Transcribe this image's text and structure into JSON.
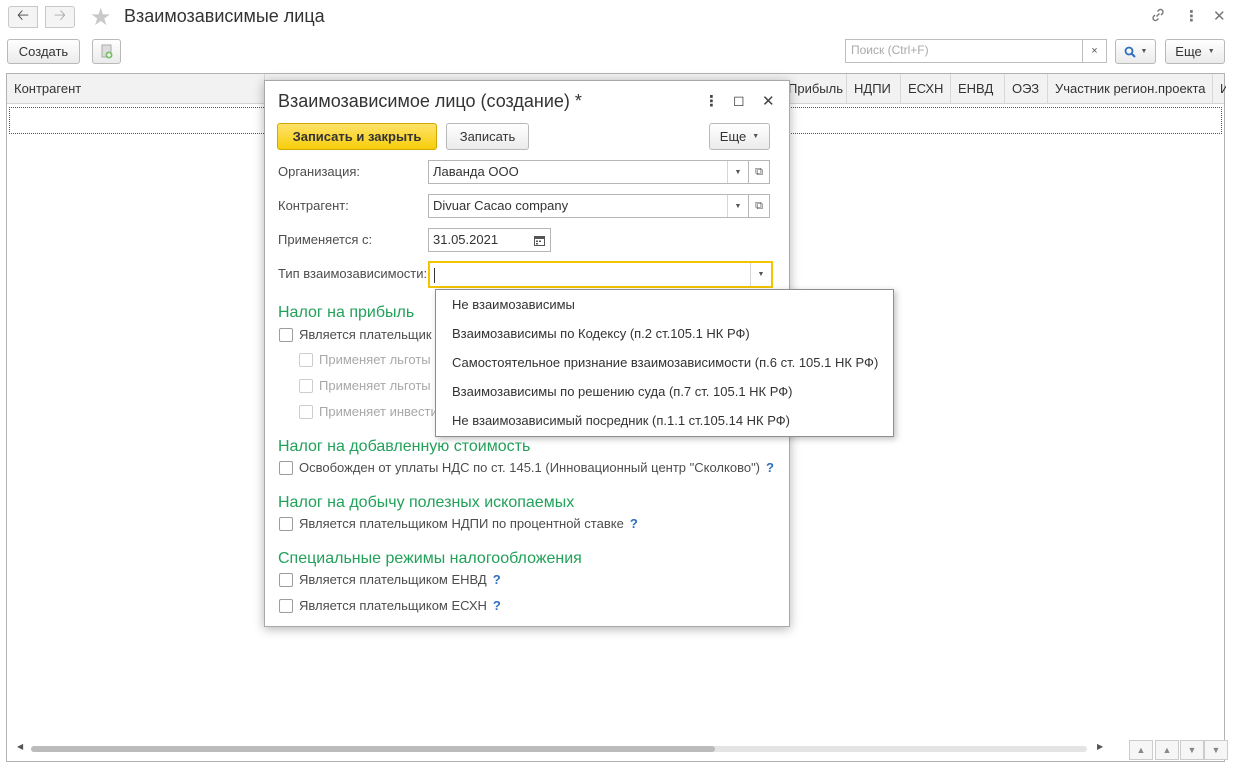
{
  "window": {
    "title": "Взаимозависимые лица"
  },
  "toolbar": {
    "create_label": "Создать",
    "search_placeholder": "Поиск (Ctrl+F)",
    "search_clear": "×",
    "search_icon": "search-icon",
    "more_label": "Еще"
  },
  "table": {
    "columns": [
      "Контрагент",
      "Прибыль",
      "НДПИ",
      "ЕСХН",
      "ЕНВД",
      "ОЭЗ",
      "Участник регион.проекта",
      "И"
    ]
  },
  "dialog": {
    "title": "Взаимозависимое лицо (создание) *",
    "save_close_label": "Записать и закрыть",
    "save_label": "Записать",
    "more_label": "Еще",
    "fields": {
      "organization_label": "Организация:",
      "organization_value": "Лаванда ООО",
      "counterparty_label": "Контрагент:",
      "counterparty_value": "Divuar Cacao company",
      "applies_from_label": "Применяется с:",
      "applies_from_value": "31.05.2021",
      "dependency_type_label": "Тип взаимозависимости:",
      "dependency_type_value": ""
    },
    "sections": {
      "profit_tax": {
        "title": "Налог на прибыль",
        "payer_label": "Является плательщик",
        "benefit1_label": "Применяет льготы",
        "benefit2_label": "Применяет льготы",
        "invest_label": "Применяет инвести"
      },
      "vat": {
        "title": "Налог на добавленную стоимость",
        "exempt_label": "Освобожден от уплаты НДС по ст. 145.1 (Инновационный центр \"Сколково\")",
        "help": "?"
      },
      "mining": {
        "title": "Налог на добычу полезных ископаемых",
        "payer_label": "Является плательщиком НДПИ по процентной ставке",
        "help": "?"
      },
      "special": {
        "title": "Специальные режимы налогообложения",
        "envd_label": "Является плательщиком ЕНВД",
        "eshn_label": "Является плательщиком ЕСХН",
        "help": "?"
      }
    }
  },
  "dropdown": {
    "options": [
      "Не взаимозависимы",
      "Взаимозависимы по Кодексу (п.2 ст.105.1 НК РФ)",
      "Самостоятельное признание взаимозависимости (п.6 ст. 105.1 НК РФ)",
      "Взаимозависимы по решению суда (п.7 ст. 105.1 НК РФ)",
      "Не взаимозависимый посредник (п.1.1 ст.105.14 НК РФ)"
    ]
  },
  "colors": {
    "accent_yellow": "#f7ce0a",
    "section_green": "#22a15a",
    "help_blue": "#2f6fbf",
    "focus_border": "#f2c500"
  }
}
